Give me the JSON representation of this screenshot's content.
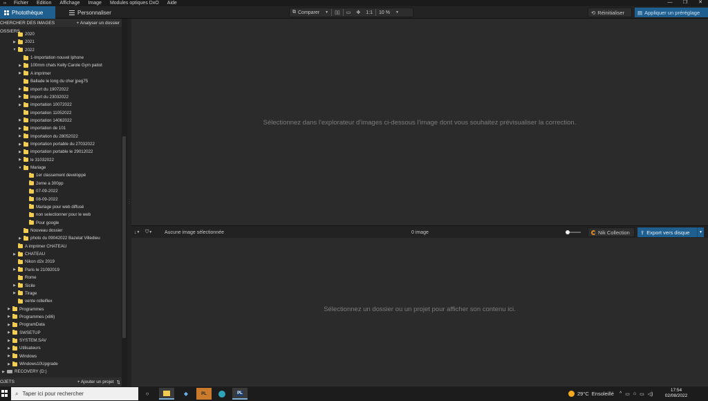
{
  "menu": {
    "items": [
      "Fichier",
      "Edition",
      "Affichage",
      "Image",
      "Modules optiques DxO",
      "Aide"
    ]
  },
  "window_controls": {
    "minimize": "—",
    "restore": "❐",
    "close": "✕"
  },
  "toolbar": {
    "tab_library": "Photothèque",
    "tab_customize": "Personnaliser",
    "compare_label": "Comparer",
    "ratio_label": "1:1",
    "zoom_value": "10 %",
    "reset_label": "Réinitialiser",
    "apply_preset_label": "Appliquer un préréglage"
  },
  "left_panel": {
    "browse_title": "CHERCHER DES IMAGES",
    "analyze_folder": "+ Analyser un dossier",
    "folders_title": "OSSIERS",
    "projects_title": "OJETS",
    "add_project": "+ Ajouter un projet",
    "tree": [
      {
        "label": "2020",
        "level": 2,
        "arrow": ""
      },
      {
        "label": "2021",
        "level": 2,
        "arrow": "▶"
      },
      {
        "label": "2022",
        "level": 2,
        "arrow": "▼"
      },
      {
        "label": "1-Importation nouvel Iphone",
        "level": 3,
        "arrow": ""
      },
      {
        "label": "100mm chats Kelly Carole Gym patiot",
        "level": 3,
        "arrow": "▶"
      },
      {
        "label": "A imprimer",
        "level": 3,
        "arrow": "▶"
      },
      {
        "label": "Ballade le long du cher jpeg75",
        "level": 3,
        "arrow": ""
      },
      {
        "label": "import du 19072022",
        "level": 3,
        "arrow": "▶"
      },
      {
        "label": "import du 23032022",
        "level": 3,
        "arrow": "▶"
      },
      {
        "label": "importation 10072022",
        "level": 3,
        "arrow": "▶"
      },
      {
        "label": "importation 11052022",
        "level": 3,
        "arrow": ""
      },
      {
        "label": "importation 14062022",
        "level": 3,
        "arrow": "▶"
      },
      {
        "label": "importation de 101",
        "level": 3,
        "arrow": "▶"
      },
      {
        "label": "Importation du 28052022",
        "level": 3,
        "arrow": "▶"
      },
      {
        "label": "Importation portable du 27032022",
        "level": 3,
        "arrow": "▶"
      },
      {
        "label": "importation portable le 29012022",
        "level": 3,
        "arrow": "▶"
      },
      {
        "label": "le 31032022",
        "level": 3,
        "arrow": "▶"
      },
      {
        "label": "Mariage",
        "level": 3,
        "arrow": "▼"
      },
      {
        "label": "1er classement developpé",
        "level": 4,
        "arrow": ""
      },
      {
        "label": "2eme a 300pp",
        "level": 4,
        "arrow": ""
      },
      {
        "label": "07-09-2022",
        "level": 4,
        "arrow": ""
      },
      {
        "label": "08-09-2022",
        "level": 4,
        "arrow": ""
      },
      {
        "label": "Mariage pour web diffusé",
        "level": 4,
        "arrow": ""
      },
      {
        "label": "non selectionner pour le web",
        "level": 4,
        "arrow": ""
      },
      {
        "label": "Pour google",
        "level": 4,
        "arrow": ""
      },
      {
        "label": "Nouveau dossier",
        "level": 3,
        "arrow": ""
      },
      {
        "label": "photo du 09042022 Bazelat Villedieu",
        "level": 3,
        "arrow": "▶"
      },
      {
        "label": "A imprimer CHATEAU",
        "level": 2,
        "arrow": ""
      },
      {
        "label": "CHATEAU",
        "level": 2,
        "arrow": "▶"
      },
      {
        "label": "Nikon d2x 2019",
        "level": 2,
        "arrow": ""
      },
      {
        "label": "Paris le 21092019",
        "level": 2,
        "arrow": "▶"
      },
      {
        "label": "Rome",
        "level": 2,
        "arrow": ""
      },
      {
        "label": "Sicile",
        "level": 2,
        "arrow": "▶"
      },
      {
        "label": "Tirage",
        "level": 2,
        "arrow": "▶"
      },
      {
        "label": "vente rolleiflex",
        "level": 2,
        "arrow": ""
      },
      {
        "label": "Programmes",
        "level": 1,
        "arrow": "▶"
      },
      {
        "label": "Programmes (x86)",
        "level": 1,
        "arrow": "▶"
      },
      {
        "label": "ProgramData",
        "level": 1,
        "arrow": "▶"
      },
      {
        "label": "SWSETUP",
        "level": 1,
        "arrow": "▶"
      },
      {
        "label": "SYSTEM.SAV",
        "level": 1,
        "arrow": "▶"
      },
      {
        "label": "Utilisateurs",
        "level": 1,
        "arrow": "▶"
      },
      {
        "label": "Windows",
        "level": 1,
        "arrow": "▶"
      },
      {
        "label": "Windows10Upgrade",
        "level": 1,
        "arrow": "▶"
      },
      {
        "label": "RECOVERY (D:)",
        "level": 0,
        "arrow": "▶",
        "drive": true
      }
    ]
  },
  "viewer": {
    "message": "Sélectionnez dans l'explorateur d'images ci-dessous l'image dont vous souhaitez prévisualiser la correction."
  },
  "filmstrip": {
    "sort_label": "↓",
    "no_selection": "Aucune image sélectionnée",
    "image_count": "0 image",
    "nik_label": "Nik Collection",
    "export_label": "Export vers disque",
    "message": "Sélectionnez un dossier ou un projet pour afficher son contenu ici."
  },
  "taskbar": {
    "search_placeholder": "Taper ici pour rechercher",
    "weather_temp": "29°C",
    "weather_desc": "Ensoleillé",
    "time": "17:54",
    "date": "02/08/2022",
    "pinned": [
      "task-view",
      "file-explorer",
      "app",
      "photolab",
      "edge",
      "photolab-active"
    ]
  },
  "colors": {
    "accent": "#1f5f8f",
    "folder": "#f2cd52",
    "background": "#2b2b2b"
  }
}
